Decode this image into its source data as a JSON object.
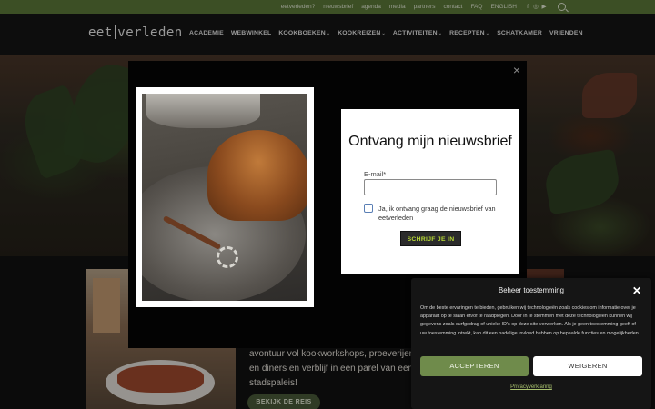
{
  "topbar": {
    "links": [
      "eetverleden?",
      "nieuwsbrief",
      "agenda",
      "media",
      "partners",
      "contact",
      "FAQ",
      "ENGLISH"
    ],
    "social_icons": [
      "facebook-icon",
      "instagram-icon",
      "youtube-icon"
    ],
    "search_icon": "search-icon"
  },
  "nav": {
    "logo_left": "eet",
    "logo_right": "verleden",
    "items": [
      {
        "label": "ACADEMIE",
        "dropdown": false
      },
      {
        "label": "WEBWINKEL",
        "dropdown": false
      },
      {
        "label": "KOOKBOEKEN",
        "dropdown": true
      },
      {
        "label": "KOOKREIZEN",
        "dropdown": true
      },
      {
        "label": "ACTIVITEITEN",
        "dropdown": true
      },
      {
        "label": "RECEPTEN",
        "dropdown": true
      },
      {
        "label": "SCHATKAMER",
        "dropdown": false
      },
      {
        "label": "VRIENDEN",
        "dropdown": false
      }
    ],
    "dropdown_glyph": "⌄"
  },
  "promo": {
    "text": "avontuur vol kookworkshops, proeverijen en diners en verblijf in een parel van een stadspaleis!",
    "button": "BEKIJK DE REIS"
  },
  "modal": {
    "close_glyph": "×",
    "title": "Ontvang mijn nieuwsbrief",
    "email_label": "E-mail*",
    "email_value": "",
    "checkbox_label": "Ja, ik ontvang graag de nieuwsbrief van eetverleden",
    "submit": "SCHRIJF JE IN"
  },
  "cookie": {
    "title": "Beheer toestemming",
    "close_glyph": "✕",
    "body": "Om de beste ervaringen te bieden, gebruiken wij technologieën zoals cookies om informatie over je apparaat op te slaan en/of te raadplegen. Door in te stemmen met deze technologieën kunnen wij gegevens zoals surfgedrag of unieke ID's op deze site verwerken. Als je geen toestemming geeft of uw toestemming intrekt, kan dit een nadelige invloed hebben op bepaalde functies en mogelijkheden.",
    "accept": "ACCEPTEREN",
    "deny": "WEIGEREN",
    "privacy": "Privacyverklaring"
  },
  "colors": {
    "topbar": "#5d7a3a",
    "accent_green": "#6f8b4b",
    "submit_text": "#b8d936"
  }
}
